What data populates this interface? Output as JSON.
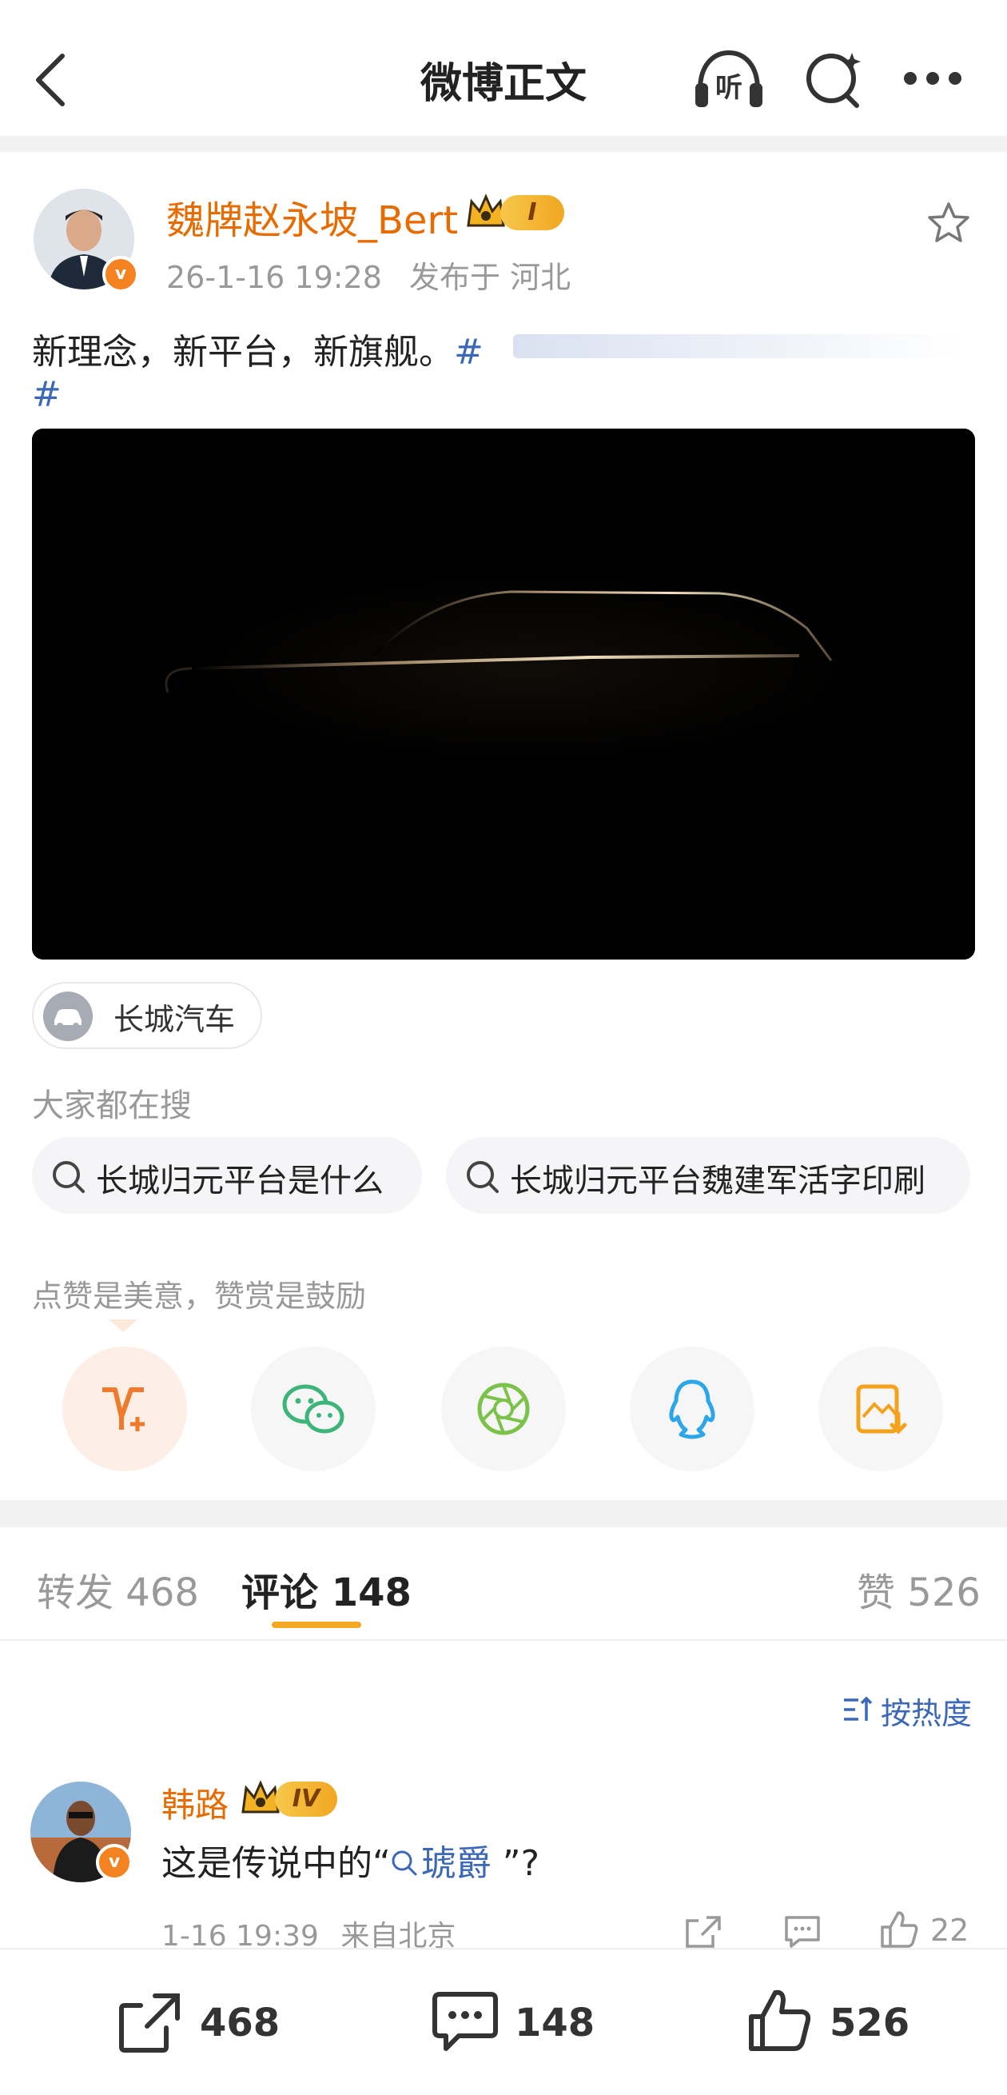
{
  "header": {
    "title": "微博正文",
    "listen_icon_label": "听"
  },
  "post": {
    "author": "魏牌赵永坡_Bert",
    "level_badge": "I",
    "timestamp": "26-1-16 19:28",
    "location": "发布于 河北",
    "text": "新理念，新平台，新旗舰。",
    "hashtag_start": "#",
    "hashtag_end": "#",
    "topic_chip": "长城汽车",
    "search_heading": "大家都在搜",
    "searches": [
      "长城归元平台是什么",
      "长城归元平台魏建军活字印刷"
    ],
    "reward_tip": "点赞是美意，赞赏是鼓励"
  },
  "tabs": {
    "repost_label": "转发",
    "repost_count": "468",
    "comment_label": "评论",
    "comment_count": "148",
    "like_label": "赞",
    "like_count": "526",
    "sort_label": "按热度"
  },
  "comment": {
    "author": "韩路",
    "level_badge": "IV",
    "text_before": "这是传说中的“",
    "link_text": "琥爵",
    "text_after": " ”?",
    "timestamp": "1-16 19:39",
    "location": "来自北京",
    "likes": "22"
  },
  "bottom": {
    "repost": "468",
    "comment": "148",
    "like": "526"
  },
  "colors": {
    "accent_orange": "#e86b00",
    "link_blue": "#3c68b8",
    "tab_underline": "#f5a623"
  }
}
